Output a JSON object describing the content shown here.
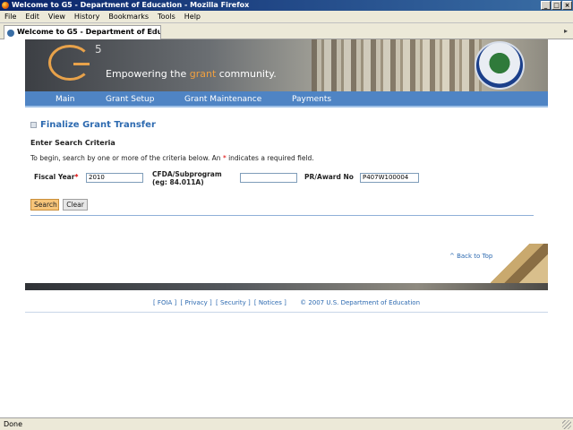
{
  "window": {
    "title": "Welcome to G5 - Department of Education - Mozilla Firefox",
    "min_label": "_",
    "max_label": "□",
    "close_label": "×"
  },
  "menu": [
    "File",
    "Edit",
    "View",
    "History",
    "Bookmarks",
    "Tools",
    "Help"
  ],
  "tab": {
    "label": "Welcome to G5 - Department of Edu...",
    "close_label": "×"
  },
  "banner": {
    "superscript": "5",
    "tagline_before": "Empowering the ",
    "tagline_accent": "grant",
    "tagline_after": " community."
  },
  "nav": [
    "Main",
    "Grant Setup",
    "Grant Maintenance",
    "Payments"
  ],
  "page": {
    "title": "Finalize Grant Transfer",
    "search_heading": "Enter Search Criteria",
    "instructions_before": "To begin, search by one or more of the criteria below. An ",
    "instructions_star": "*",
    "instructions_after": " indicates a required field."
  },
  "form": {
    "fiscal_year_label": "Fiscal Year",
    "fiscal_year_star": "*",
    "fiscal_year_value": "2010",
    "cfda_label_line1": "CFDA/Subprogram",
    "cfda_label_line2": "(eg: 84.011A)",
    "cfda_value": "",
    "pr_award_label": "PR/Award No",
    "pr_award_value": "P407W100004",
    "search_label": "Search",
    "clear_label": "Clear"
  },
  "back_to_top": "^ Back to Top",
  "footer": {
    "links": [
      "[ FOIA ]",
      "[ Privacy ]",
      "[ Security ]",
      "[ Notices ]"
    ],
    "copyright": "© 2007 U.S. Department of Education"
  },
  "status": {
    "text": "Done"
  },
  "colors": {
    "nav_bg": "#4f84c4",
    "link": "#2d6ab0",
    "search_button": "#f7c57a",
    "required": "#dd0000"
  }
}
